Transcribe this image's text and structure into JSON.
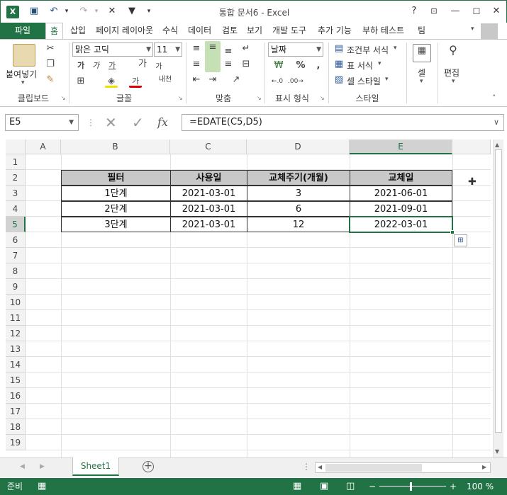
{
  "window": {
    "title": "통합 문서6 - Excel",
    "help": "?",
    "minimize": "—",
    "close": "✕"
  },
  "tabs": [
    "파일",
    "홈",
    "삽입",
    "페이지 레이아웃",
    "수식",
    "데이터",
    "검토",
    "보기",
    "개발 도구",
    "추가 기능",
    "부하 테스트",
    "팀"
  ],
  "ribbon": {
    "clipboard": {
      "paste": "붙여넣기",
      "label": "클립보드"
    },
    "font": {
      "name": "맑은 고딕",
      "size": "11",
      "label": "글꼴"
    },
    "alignment": {
      "label": "맞춤"
    },
    "number": {
      "format": "날짜",
      "percent": "%",
      "label": "표시 형식"
    },
    "styles": {
      "conditional": "조건부 서식",
      "table": "표 서식",
      "cell_style": "셀 스타일",
      "label": "스타일"
    },
    "cells": {
      "label": "셀"
    },
    "editing": {
      "label": "편집"
    }
  },
  "formula_bar": {
    "name_box": "E5",
    "formula": "=EDATE(C5,D5)"
  },
  "columns": [
    "A",
    "B",
    "C",
    "D",
    "E"
  ],
  "rows": [
    "1",
    "2",
    "3",
    "4",
    "5",
    "6",
    "7",
    "8",
    "9",
    "10",
    "11",
    "12",
    "13",
    "14",
    "15",
    "16",
    "17",
    "18",
    "19"
  ],
  "table": {
    "headers": [
      "필터",
      "사용일",
      "교체주기(개월)",
      "교체일"
    ],
    "rows": [
      [
        "1단계",
        "2021-03-01",
        "3",
        "2021-06-01"
      ],
      [
        "2단계",
        "2021-03-01",
        "6",
        "2021-09-01"
      ],
      [
        "3단계",
        "2021-03-01",
        "12",
        "2022-03-01"
      ]
    ]
  },
  "sheet_tabs": [
    "Sheet1"
  ],
  "status": {
    "mode": "준비",
    "zoom": "100 %"
  },
  "colors": {
    "accent": "#217346"
  }
}
